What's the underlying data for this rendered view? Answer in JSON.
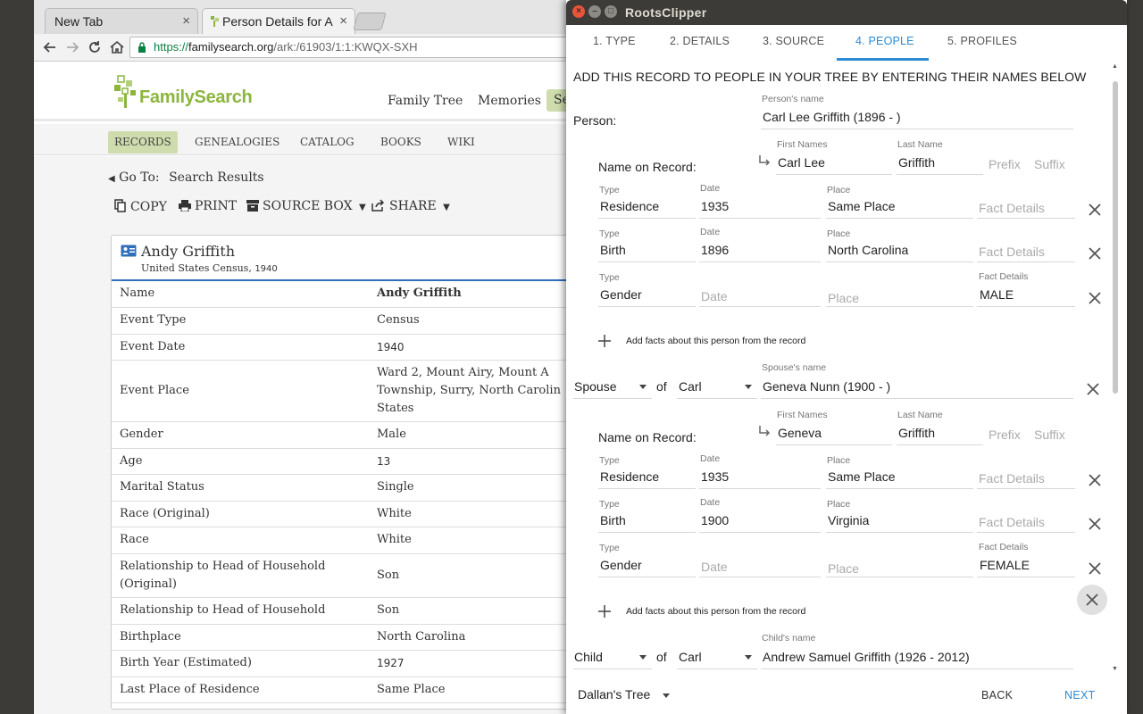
{
  "browser": {
    "tabs": [
      {
        "title": "New Tab",
        "close": "×"
      },
      {
        "title": "Person Details for A",
        "close": "×"
      }
    ],
    "url": {
      "https": "https://",
      "domain": "familysearch.org",
      "path": "/ark:/61903/1:1:KWQX-SXH"
    }
  },
  "familysearch": {
    "logo_text": "FamilySearch",
    "nav": [
      "Family Tree",
      "Memories",
      "Se"
    ],
    "subnav": [
      "RECORDS",
      "GENEALOGIES",
      "CATALOG",
      "BOOKS",
      "WIKI"
    ],
    "goto_label": "Go To:",
    "goto_link": "Search Results",
    "actions": {
      "copy": "COPY",
      "print": "PRINT",
      "source_box": "SOURCE BOX",
      "share": "SHARE"
    },
    "record": {
      "name": "Andy Griffith",
      "collection": "United States Census,",
      "collection_year": "1940",
      "rows": [
        {
          "label": "Name",
          "value": "Andy Griffith"
        },
        {
          "label": "Event Type",
          "value": "Census"
        },
        {
          "label": "Event Date",
          "value": "1940"
        },
        {
          "label": "Event Place",
          "value": "Ward 2, Mount Airy, Mount A",
          "value2": "Township, Surry, North Carolin",
          "value3": "States"
        },
        {
          "label": "Gender",
          "value": "Male"
        },
        {
          "label": "Age",
          "value": "13"
        },
        {
          "label": "Marital Status",
          "value": "Single"
        },
        {
          "label": "Race (Original)",
          "value": "White"
        },
        {
          "label": "Race",
          "value": "White"
        },
        {
          "label": "Relationship to Head of Household",
          "label2": "(Original)",
          "value": "Son"
        },
        {
          "label": "Relationship to Head of Household",
          "value": "Son"
        },
        {
          "label": "Birthplace",
          "value": "North Carolina"
        },
        {
          "label": "Birth Year (Estimated)",
          "value": "1927"
        },
        {
          "label": "Last Place of Residence",
          "value": "Same Place"
        }
      ]
    }
  },
  "rootsclipper": {
    "title": "RootsClipper",
    "tabs": [
      "1. TYPE",
      "2. DETAILS",
      "3. SOURCE",
      "4. PEOPLE",
      "5. PROFILES"
    ],
    "active_tab": 3,
    "heading": "ADD THIS RECORD TO PEOPLE IN YOUR TREE BY ENTERING THEIR NAMES BELOW",
    "labels": {
      "person": "Person:",
      "persons_name": "Person's name",
      "spouses_name": "Spouse's name",
      "childs_name": "Child's name",
      "name_on_record": "Name on Record:",
      "first_names": "First Names",
      "last_name": "Last Name",
      "prefix": "Prefix",
      "suffix": "Suffix",
      "type": "Type",
      "date": "Date",
      "place": "Place",
      "fact_details": "Fact Details",
      "of": "of",
      "add_facts": "Add facts about this person from the record"
    },
    "person": {
      "name": "Carl Lee Griffith (1896 - )",
      "first": "Carl Lee",
      "last": "Griffith",
      "facts": [
        {
          "type": "Residence",
          "date": "1935",
          "place": "Same Place",
          "details": ""
        },
        {
          "type": "Birth",
          "date": "1896",
          "place": "North Carolina",
          "details": ""
        },
        {
          "type": "Gender",
          "date": "",
          "place": "",
          "details": "MALE"
        }
      ]
    },
    "spouse": {
      "relation": "Spouse",
      "of": "Carl",
      "name": "Geneva Nunn (1900 - )",
      "first": "Geneva",
      "last": "Griffith",
      "facts": [
        {
          "type": "Residence",
          "date": "1935",
          "place": "Same Place",
          "details": ""
        },
        {
          "type": "Birth",
          "date": "1900",
          "place": "Virginia",
          "details": ""
        },
        {
          "type": "Gender",
          "date": "",
          "place": "",
          "details": "FEMALE"
        }
      ]
    },
    "child": {
      "relation": "Child",
      "of": "Carl",
      "name": "Andrew Samuel Griffith (1926 - 2012)"
    },
    "footer": {
      "tree": "Dallan's Tree",
      "back": "BACK",
      "next": "NEXT"
    }
  }
}
